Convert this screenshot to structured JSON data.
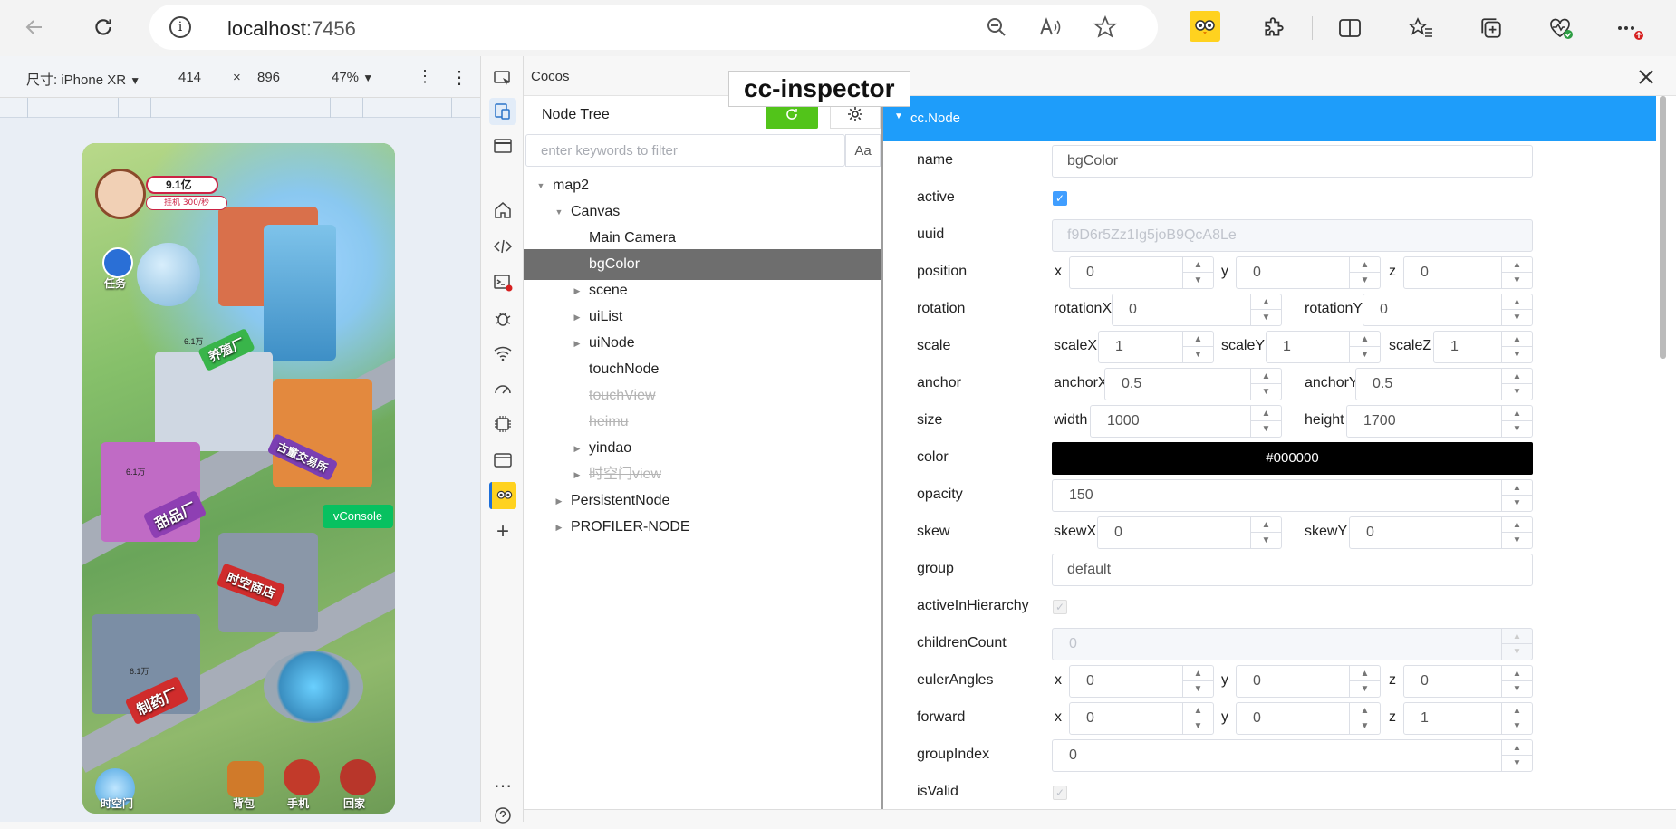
{
  "browser": {
    "url_host": "localhost",
    "url_port": ":7456"
  },
  "device_toolbar": {
    "device_label": "尺寸: iPhone XR",
    "width": "414",
    "times": "×",
    "height": "896",
    "zoom": "47%"
  },
  "game": {
    "money": "9.1亿",
    "rate": "挂机 300/秒",
    "task": "任务",
    "sign_factory": "养殖厂",
    "sign_antique": "古董交易所",
    "sign_sweets": "甜品厂",
    "sign_shop": "时空商店",
    "sign_pharma": "制药厂",
    "coin1": "6.1万",
    "coin2": "6.1万",
    "coin3": "6.1万",
    "vconsole": "vConsole",
    "btn_portal": "时空门",
    "btn_bag": "背包",
    "btn_phone": "手机",
    "btn_home": "回家"
  },
  "panel": {
    "title": "Cocos",
    "badge": "cc-inspector"
  },
  "tree": {
    "title": "Node Tree",
    "filter_placeholder": "enter keywords to filter",
    "case_label": "Aa",
    "nodes": [
      {
        "label": "map2",
        "depth": 0,
        "arrow": "expanded"
      },
      {
        "label": "Canvas",
        "depth": 1,
        "arrow": "expanded"
      },
      {
        "label": "Main Camera",
        "depth": 2,
        "arrow": "none"
      },
      {
        "label": "bgColor",
        "depth": 2,
        "arrow": "none",
        "selected": true
      },
      {
        "label": "scene",
        "depth": 2,
        "arrow": "collapsed"
      },
      {
        "label": "uiList",
        "depth": 2,
        "arrow": "collapsed"
      },
      {
        "label": "uiNode",
        "depth": 2,
        "arrow": "collapsed"
      },
      {
        "label": "touchNode",
        "depth": 2,
        "arrow": "none"
      },
      {
        "label": "touchView",
        "depth": 2,
        "arrow": "none",
        "inactive": true
      },
      {
        "label": "heimu",
        "depth": 2,
        "arrow": "none",
        "inactive": true
      },
      {
        "label": "yindao",
        "depth": 2,
        "arrow": "collapsed"
      },
      {
        "label": "时空门view",
        "depth": 2,
        "arrow": "collapsed",
        "inactive": true
      },
      {
        "label": "PersistentNode",
        "depth": 1,
        "arrow": "collapsed"
      },
      {
        "label": "PROFILER-NODE",
        "depth": 1,
        "arrow": "collapsed"
      }
    ]
  },
  "props": {
    "header": "cc.Node",
    "name": {
      "label": "name",
      "value": "bgColor"
    },
    "active": {
      "label": "active",
      "checked": true
    },
    "uuid": {
      "label": "uuid",
      "value": "f9D6r5Zz1Ig5joB9QcA8Le"
    },
    "position": {
      "label": "position",
      "x": "x",
      "y": "y",
      "z": "z",
      "xv": "0",
      "yv": "0",
      "zv": "0"
    },
    "rotation": {
      "label": "rotation",
      "xl": "rotationX",
      "yl": "rotationY",
      "xv": "0",
      "yv": "0"
    },
    "scale": {
      "label": "scale",
      "xl": "scaleX",
      "yl": "scaleY",
      "zl": "scaleZ",
      "xv": "1",
      "yv": "1",
      "zv": "1"
    },
    "anchor": {
      "label": "anchor",
      "xl": "anchorX",
      "yl": "anchorY",
      "xv": "0.5",
      "yv": "0.5"
    },
    "size": {
      "label": "size",
      "wl": "width",
      "hl": "height",
      "wv": "1000",
      "hv": "1700"
    },
    "color": {
      "label": "color",
      "value": "#000000"
    },
    "opacity": {
      "label": "opacity",
      "value": "150"
    },
    "skew": {
      "label": "skew",
      "xl": "skewX",
      "yl": "skewY",
      "xv": "0",
      "yv": "0"
    },
    "group": {
      "label": "group",
      "value": "default"
    },
    "activeInHierarchy": {
      "label": "activeInHierarchy"
    },
    "childrenCount": {
      "label": "childrenCount",
      "value": "0"
    },
    "eulerAngles": {
      "label": "eulerAngles",
      "x": "x",
      "y": "y",
      "z": "z",
      "xv": "0",
      "yv": "0",
      "zv": "0"
    },
    "forward": {
      "label": "forward",
      "x": "x",
      "y": "y",
      "z": "z",
      "xv": "0",
      "yv": "0",
      "zv": "1"
    },
    "groupIndex": {
      "label": "groupIndex",
      "value": "0"
    },
    "isValid": {
      "label": "isValid"
    }
  },
  "colors": {
    "accent": "#1e9dfa",
    "refresh": "#52c41a",
    "selected_row": "#6e6e6e",
    "checkbox": "#409eff"
  }
}
